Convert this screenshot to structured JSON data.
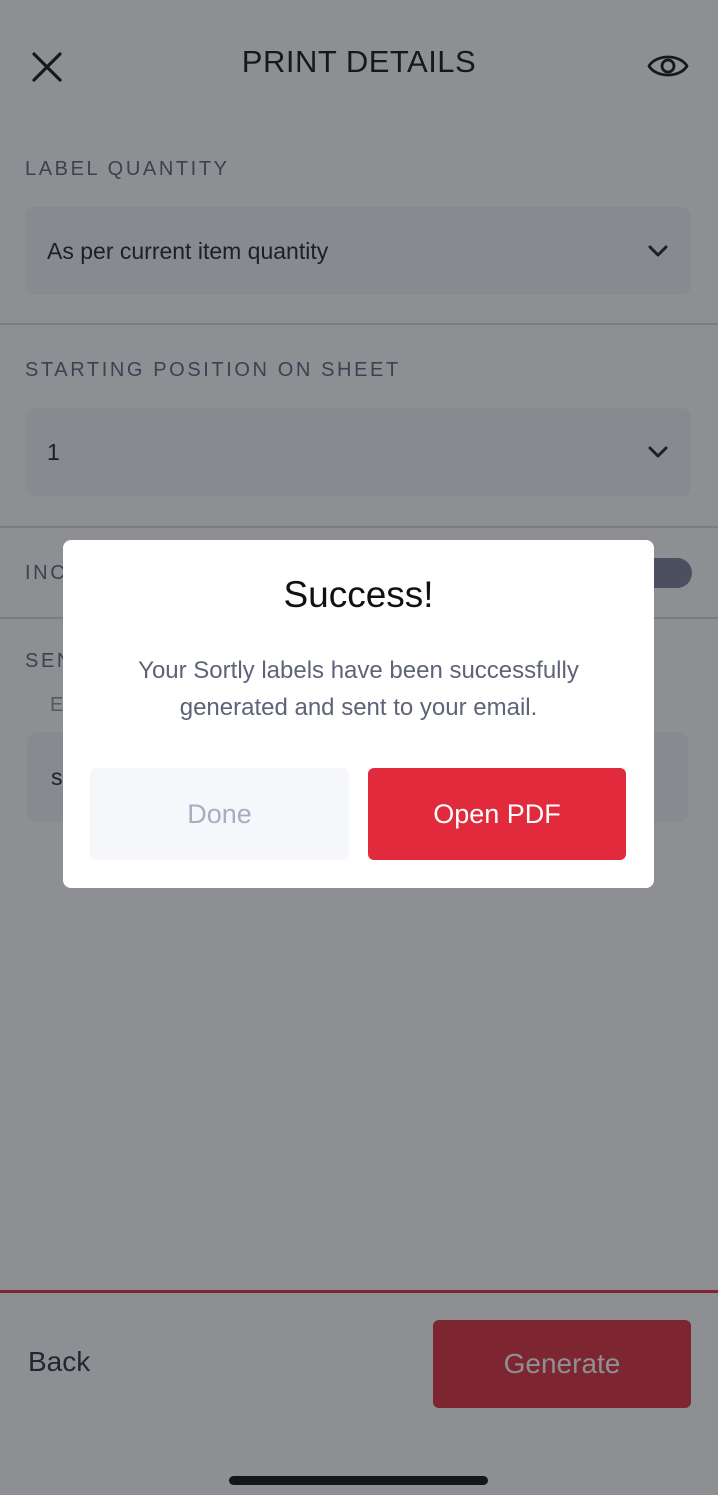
{
  "header": {
    "title": "PRINT DETAILS",
    "close_icon": "close-icon",
    "preview_icon": "eye-icon"
  },
  "label_quantity": {
    "label": "LABEL QUANTITY",
    "value": "As per current item quantity"
  },
  "starting_position": {
    "label": "STARTING POSITION ON SHEET",
    "value": "1"
  },
  "include_section": {
    "label_partial": "INC"
  },
  "send_section": {
    "label_partial": "SEN",
    "input_placeholder_partial": "E",
    "input_value_partial": "s"
  },
  "footer": {
    "back_label": "Back",
    "generate_label": "Generate"
  },
  "modal": {
    "title": "Success!",
    "message": "Your Sortly labels have been successfully generated and sent to your email.",
    "done_label": "Done",
    "open_pdf_label": "Open PDF"
  },
  "colors": {
    "accent": "#e12a3c",
    "overlay": "rgba(28, 31, 40, 0.5)"
  }
}
